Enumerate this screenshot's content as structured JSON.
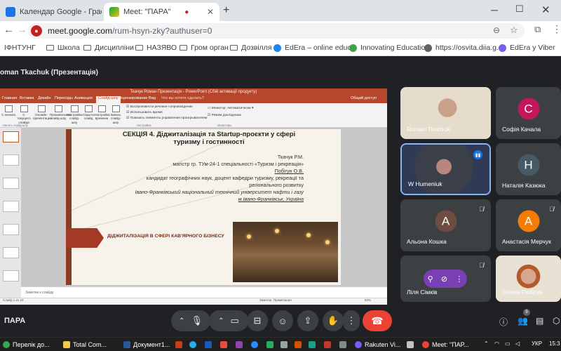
{
  "browser": {
    "tabs": [
      {
        "label": "Календар Google - Графік по"
      },
      {
        "label": "Meet: \"ПАРА\""
      }
    ],
    "url_host": "meet.google.com",
    "url_path": "/rum-hsyn-zky?authuser=0",
    "bookmarks": [
      {
        "label": "ІФНТУНГ"
      },
      {
        "label": "Школа"
      },
      {
        "label": "Дисципліни"
      },
      {
        "label": "НАЗЯВО"
      },
      {
        "label": "Гром орган"
      },
      {
        "label": "Дозвілля"
      },
      {
        "label": "EdEra – online educ..."
      },
      {
        "label": "Innovating Educatio..."
      },
      {
        "label": "https://osvita.diia.g..."
      },
      {
        "label": "EdEra у Viber"
      }
    ]
  },
  "meet": {
    "presenter_label": "oman Tkachuk (Презентація)",
    "meeting_name": "ПАРА",
    "participants_count": "9",
    "tiles": [
      {
        "name": "Roman Tkachuk",
        "type": "video"
      },
      {
        "name": "Софія Качала",
        "initial": "С",
        "avatar_color": "#c2185b"
      },
      {
        "name": "W Humeniuk",
        "type": "video"
      },
      {
        "name": "Наталія Казюка",
        "initial": "Н",
        "avatar_color": "#455a64"
      },
      {
        "name": "Альона Кошка",
        "initial": "А",
        "avatar_color": "#6d4c41"
      },
      {
        "name": "Анастасія Мерчук",
        "initial": "А",
        "avatar_color": "#f57c00"
      },
      {
        "name": "Ліля Сімків",
        "type": "pinned"
      },
      {
        "name": "Олена Побігун",
        "type": "video"
      }
    ]
  },
  "powerpoint": {
    "window_title": "Ткачук Роман Презентація - PowerPoint (Сбій активації продукту)",
    "ribbon_tabs": [
      "Главная",
      "Вставка",
      "Дизайн",
      "Переходы",
      "Анимация",
      "Слайд-шоу",
      "Рецензирование",
      "Вид",
      "Что вы хотите сделать?"
    ],
    "ribbon_buttons": [
      "С начала",
      "С текущего слайда",
      "Онлайн-презентация",
      "Произвольное слайд-шоу",
      "Настройка слайд-шоу",
      "Скрыть слайд",
      "Настройка времени",
      "Запись слайд-шоу"
    ],
    "ribbon_checks": [
      "Воспроизвести речевое сопровождение",
      "Использовать время",
      "Показать элементы управления проигрывателем"
    ],
    "monitor_label": "Монитор: Автоматически",
    "presenter_view_label": "Режим докладчика",
    "group_labels": [
      "Начать слайд-шоу",
      "Настройка",
      "Мониторы"
    ],
    "share_label": "Общий доступ",
    "notes_placeholder": "Заметки к слайду",
    "status_slide": "Слайд 1 из 10",
    "status_notes": "Заметки",
    "status_comments": "Примечания",
    "status_zoom": "83%"
  },
  "slide": {
    "title": "СЕКЦІЯ 4. Діджиталізація та Startup-проєкти у сфері туризму і гостинності",
    "lines": [
      "Ткачук Р.М.",
      "магістр гр. ТУм-24-1 спеціальності «Туризм і рекреація»",
      "Побігун О.В.",
      "кандидат географічних наук, доцент кафедри туризму, рекреації та",
      "регіонального розвитку",
      "Івано-Франківський національний технічний університет нафти і газу",
      "м.Івано-Франківськ, Україна"
    ],
    "subtitle": "ДІДЖИТАЛІЗАЦІЯ В СФЕРІ КАВ'ЯРНОГО БІЗНЕСУ"
  },
  "taskbar": {
    "items": [
      {
        "label": "Перелік до..."
      },
      {
        "label": "Total Com..."
      },
      {
        "label": "Документ1..."
      },
      {
        "label": "Rakuten Vi..."
      },
      {
        "label": "Meet: \"ПАР..."
      }
    ],
    "lang": "УКР",
    "time": "15:3"
  },
  "colors": {
    "accent_ppt": "#b7472a",
    "leave": "#ea4335",
    "meet_bg": "#202124"
  }
}
